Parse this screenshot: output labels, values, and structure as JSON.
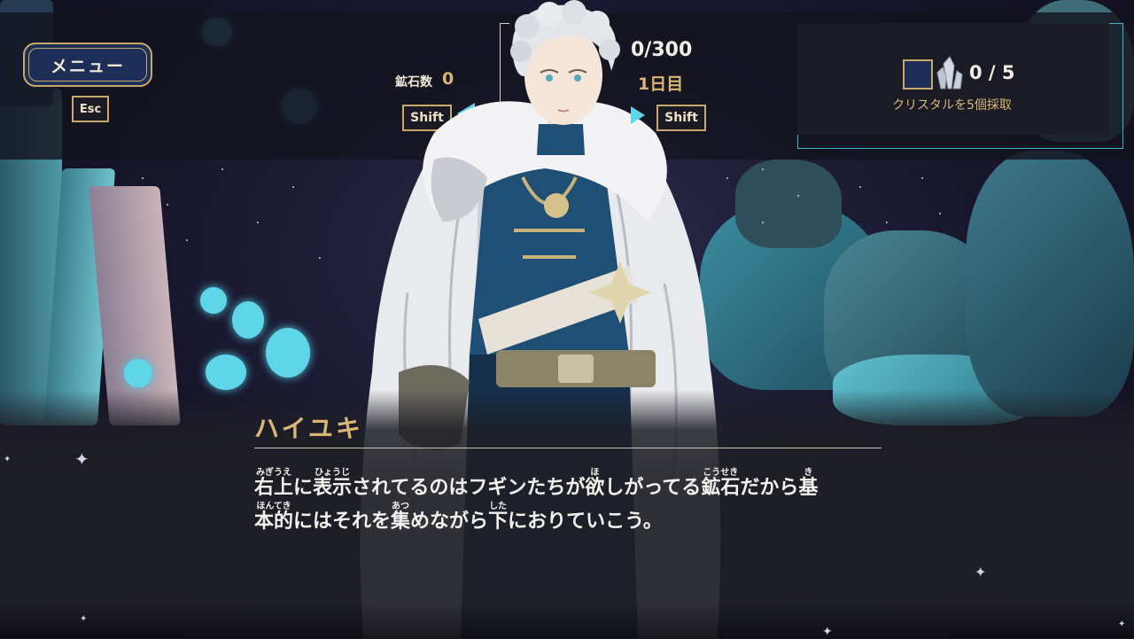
{
  "hud": {
    "menu_label": "メニュー",
    "esc_key": "Esc",
    "ore_label": "鉱石数",
    "ore_count": "0",
    "shift_left": "Shift",
    "shift_right": "Shift",
    "depth": "0/300",
    "day": "1日目"
  },
  "quest": {
    "progress": "0 / 5",
    "objective": "クリスタルを5個採取"
  },
  "dialogue": {
    "speaker": "ハイユキ",
    "line1": [
      {
        "text": "右上",
        "ruby": "みぎうえ"
      },
      {
        "text": "に"
      },
      {
        "text": "表示",
        "ruby": "ひょうじ"
      },
      {
        "text": "されてるのはフギンたちが"
      },
      {
        "text": "欲",
        "ruby": "ほ"
      },
      {
        "text": "しがってる"
      },
      {
        "text": "鉱石",
        "ruby": "こうせき"
      },
      {
        "text": "だから"
      },
      {
        "text": "基",
        "ruby": "き"
      }
    ],
    "line2": [
      {
        "text": "本的",
        "ruby": "ほんてき"
      },
      {
        "text": "にはそれを"
      },
      {
        "text": "集",
        "ruby": "あつ"
      },
      {
        "text": "めながら"
      },
      {
        "text": "下",
        "ruby": "した"
      },
      {
        "text": "におりていこう。"
      }
    ]
  },
  "colors": {
    "gold": "#d8b772",
    "accent_cyan": "#5fd6e8",
    "panel": "#1b1b26",
    "menu_blue": "#1e2f57"
  },
  "icons": [
    "crystal-cluster-icon",
    "sparkle-icon",
    "page-arrow-left-icon",
    "page-arrow-right-icon"
  ]
}
